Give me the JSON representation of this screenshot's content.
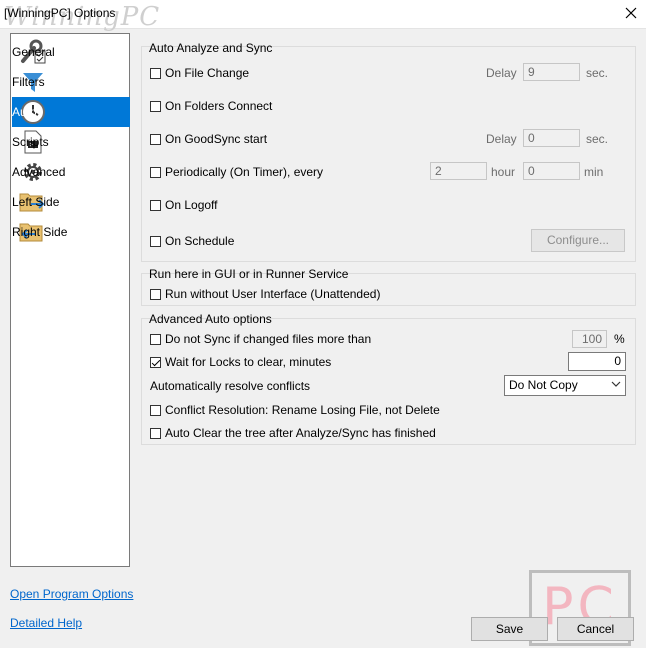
{
  "window": {
    "title": "[WinningPC] Options",
    "watermark": "WinningPC"
  },
  "sidebar": {
    "items": [
      {
        "label": "General",
        "icon": "wrench-checklist-icon"
      },
      {
        "label": "Filters",
        "icon": "funnel-icon"
      },
      {
        "label": "Auto",
        "icon": "clock-icon"
      },
      {
        "label": "Scripts",
        "icon": "script-icon"
      },
      {
        "label": "Advanced",
        "icon": "gear-icon"
      },
      {
        "label": "Left Side",
        "icon": "folder-arrow-right-icon"
      },
      {
        "label": "Right Side",
        "icon": "folder-arrow-left-icon"
      }
    ],
    "active": "Auto"
  },
  "auto_sync": {
    "title": "Auto Analyze and Sync",
    "on_file_change": {
      "label": "On File Change",
      "checked": false,
      "delay_label": "Delay",
      "delay_value": "9",
      "unit": "sec."
    },
    "on_folders_connect": {
      "label": "On Folders Connect",
      "checked": false
    },
    "on_goodsync_start": {
      "label": "On GoodSync start",
      "checked": false,
      "delay_label": "Delay",
      "delay_value": "0",
      "unit": "sec."
    },
    "periodically": {
      "label": "Periodically (On Timer), every",
      "checked": false,
      "hour_value": "2",
      "hour_label": "hour",
      "min_value": "0",
      "min_label": "min"
    },
    "on_logoff": {
      "label": "On Logoff",
      "checked": false
    },
    "on_schedule": {
      "label": "On Schedule",
      "checked": false,
      "configure_label": "Configure..."
    }
  },
  "runner": {
    "title": "Run here in GUI or in Runner Service",
    "unattended": {
      "label": "Run without User Interface (Unattended)",
      "checked": false
    }
  },
  "advanced_auto": {
    "title": "Advanced Auto options",
    "do_not_sync": {
      "label": "Do not Sync if changed files more than",
      "checked": false,
      "value": "100",
      "unit": "%"
    },
    "wait_locks": {
      "label": "Wait for Locks to clear, minutes",
      "checked": true,
      "value": "0"
    },
    "resolve_label": "Automatically resolve conflicts",
    "resolve_value": "Do Not Copy",
    "conflict_resolution": {
      "label": "Conflict Resolution: Rename Losing File, not Delete",
      "checked": false
    },
    "auto_clear": {
      "label": "Auto Clear the tree after Analyze/Sync has finished",
      "checked": false
    }
  },
  "footer": {
    "open_program_options": "Open Program Options",
    "detailed_help": "Detailed Help",
    "save_label": "Save",
    "cancel_label": "Cancel",
    "logo_text": "PC"
  },
  "colors": {
    "accent": "#0078d7",
    "link": "#0066cc",
    "logo_pink": "#f3b6c0"
  }
}
